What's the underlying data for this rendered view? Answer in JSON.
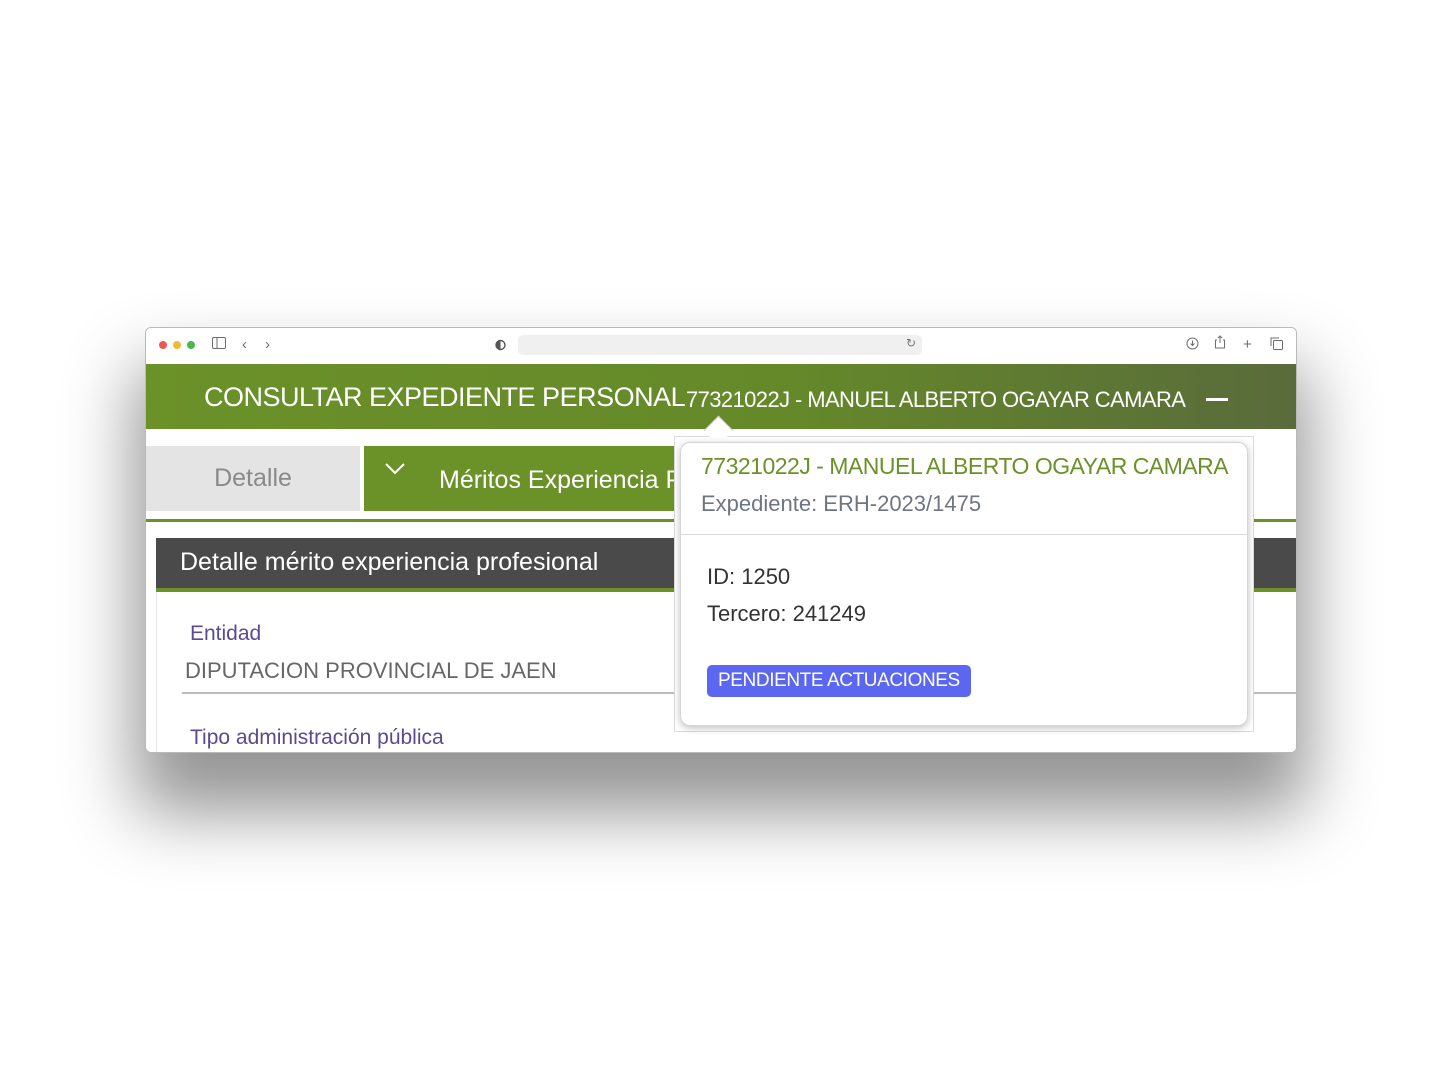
{
  "browser": {
    "url": "",
    "icons": [
      "sidebar-icon",
      "back-icon",
      "forward-icon",
      "shield-icon",
      "reload-icon",
      "download-icon",
      "share-icon",
      "new-tab-icon",
      "tabs-icon"
    ]
  },
  "header": {
    "title": "CONSULTAR EXPEDIENTE PERSONAL",
    "person": "77321022J - MANUEL ALBERTO OGAYAR CAMARA",
    "collapse_glyph": "—"
  },
  "tabs": [
    {
      "label": "Detalle"
    },
    {
      "label": "Méritos Experiencia Profesional",
      "icon": "chevron-down-icon"
    }
  ],
  "section": {
    "title": "Detalle mérito experiencia profesional",
    "fields": [
      {
        "label": "Entidad",
        "value": "DIPUTACION PROVINCIAL DE JAEN"
      },
      {
        "label": "Tipo administración pública",
        "value": ""
      }
    ]
  },
  "popover": {
    "title": "77321022J - MANUEL ALBERTO OGAYAR CAMARA",
    "subtitle": "Expediente: ERH-2023/1475",
    "id_line": "ID: 1250",
    "tercero_line": "Tercero: 241249",
    "badge": "PENDIENTE ACTUACIONES"
  },
  "colors": {
    "brand_green": "#6b9129",
    "header_dark": "#4a4a4a",
    "label_purple": "#5b4a8e",
    "badge_blue": "#5b67f0"
  }
}
